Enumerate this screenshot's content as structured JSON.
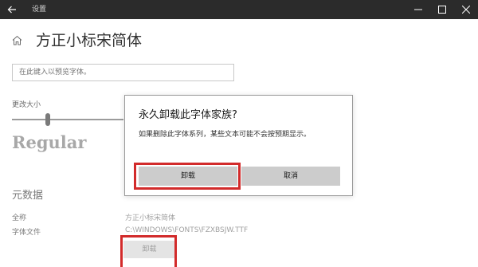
{
  "window": {
    "title": "设置"
  },
  "page": {
    "title": "方正小标宋简体",
    "preview_placeholder": "在此键入以预览字体。"
  },
  "size": {
    "label": "更改大小",
    "slider_value": 0.32,
    "preview_text": "Regular"
  },
  "metadata": {
    "heading": "元数据",
    "fullname_label": "全称",
    "fullname_value": "方正小标宋简体",
    "file_label": "字体文件",
    "file_value": "C:\\WINDOWS\\FONTS\\FZXBSJW.TTF",
    "uninstall_label": "卸载"
  },
  "dialog": {
    "title": "永久卸载此字体家族?",
    "message": "如果删除此字体系列，某些文本可能不会按预期显示。",
    "uninstall_label": "卸载",
    "cancel_label": "取消"
  },
  "colors": {
    "titlebar": "#2b2b2b",
    "highlight": "#d22b2b",
    "button": "#cccccc"
  }
}
